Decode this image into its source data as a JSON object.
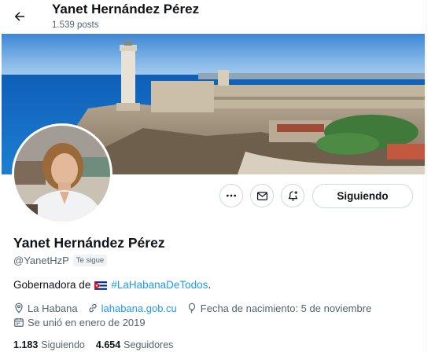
{
  "header": {
    "title": "Yanet Hernández Pérez",
    "posts_count": "1.539 posts"
  },
  "actions": {
    "more_icon": "more-horizontal-icon",
    "message_icon": "envelope-icon",
    "subscribe_icon": "notification-bell-plus-icon",
    "follow_label": "Siguiendo"
  },
  "profile": {
    "name": "Yanet Hernández Pérez",
    "handle": "@YanetHzP",
    "follows_you_badge": "Te sigue",
    "bio_prefix": "Gobernadora de",
    "bio_flag": "cuba-flag",
    "bio_hashtag": "#LaHabanaDeTodos",
    "bio_suffix": ".",
    "location": "La Habana",
    "website": "lahabana.gob.cu",
    "birthday": "Fecha de nacimiento: 5 de noviembre",
    "joined": "Se unió en enero de 2019"
  },
  "stats": {
    "following_count": "1.183",
    "following_label": "Siguiendo",
    "followers_count": "4.654",
    "followers_label": "Seguidores"
  },
  "colors": {
    "text_primary": "#0f1419",
    "text_secondary": "#536471",
    "accent": "#1d9bf0",
    "border": "#cfd9de"
  }
}
